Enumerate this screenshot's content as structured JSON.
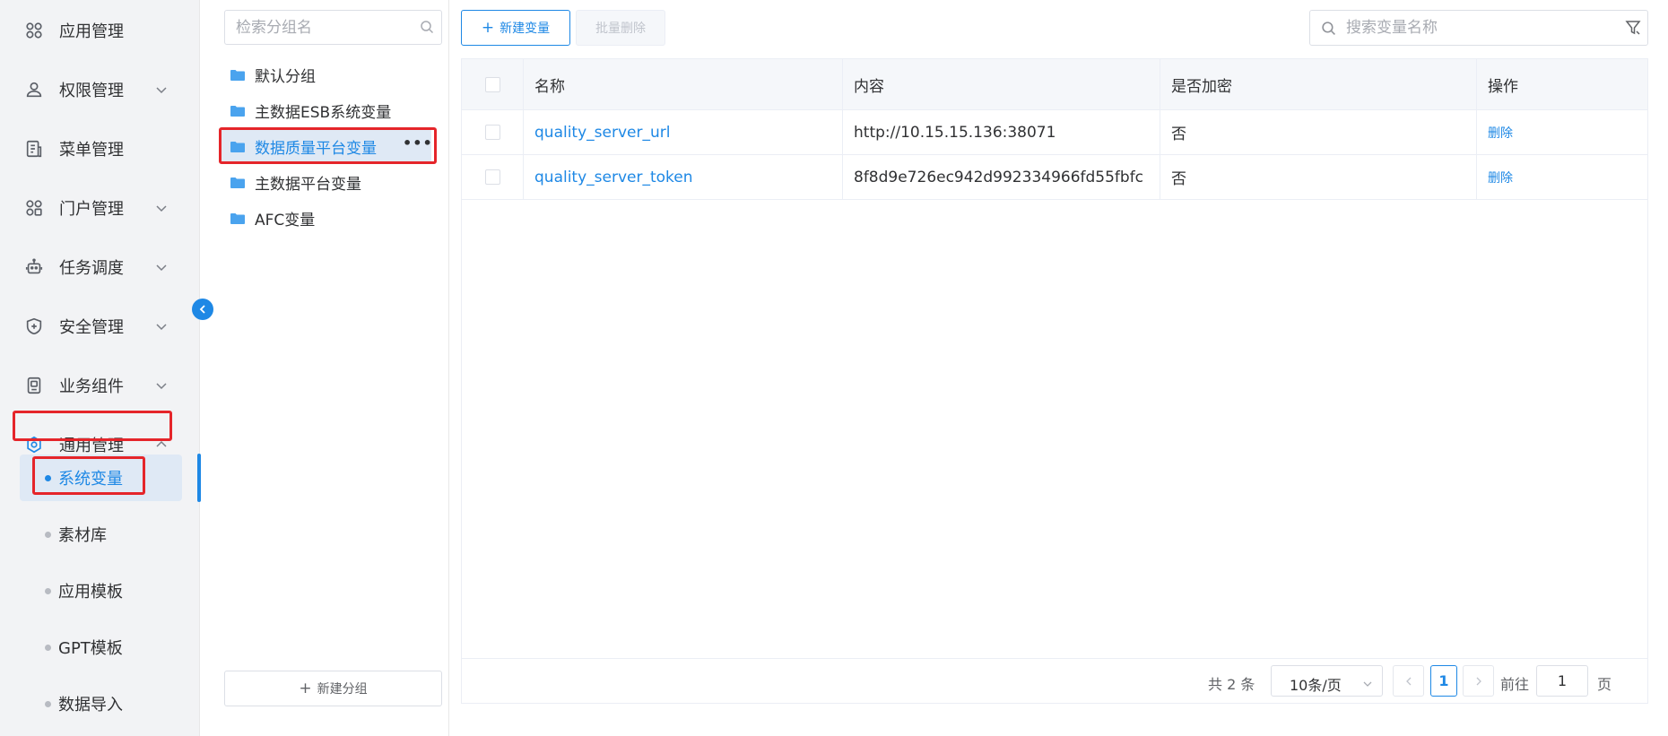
{
  "colors": {
    "accent": "#1e88e5",
    "highlight_border": "#e5252a",
    "nav_bg": "#f2f3f5"
  },
  "nav": {
    "items": [
      {
        "label": "应用管理",
        "icon": "grid-icon",
        "expandable": false
      },
      {
        "label": "权限管理",
        "icon": "user-icon",
        "expandable": true
      },
      {
        "label": "菜单管理",
        "icon": "menu-doc-icon",
        "expandable": false
      },
      {
        "label": "门户管理",
        "icon": "portal-grid-icon",
        "expandable": true
      },
      {
        "label": "任务调度",
        "icon": "robot-icon",
        "expandable": true
      },
      {
        "label": "安全管理",
        "icon": "shield-icon",
        "expandable": true
      },
      {
        "label": "业务组件",
        "icon": "component-icon",
        "expandable": true
      },
      {
        "label": "通用管理",
        "icon": "settings-icon",
        "expandable": true,
        "expanded": true
      }
    ],
    "subitems": [
      {
        "label": "系统变量",
        "selected": true
      },
      {
        "label": "素材库",
        "selected": false
      },
      {
        "label": "应用模板",
        "selected": false
      },
      {
        "label": "GPT模板",
        "selected": false
      },
      {
        "label": "数据导入",
        "selected": false
      }
    ]
  },
  "groups": {
    "search_placeholder": "检索分组名",
    "items": [
      {
        "label": "默认分组",
        "selected": false
      },
      {
        "label": "主数据ESB系统变量",
        "selected": false
      },
      {
        "label": "数据质量平台变量",
        "selected": true
      },
      {
        "label": "主数据平台变量",
        "selected": false
      },
      {
        "label": "AFC变量",
        "selected": false
      }
    ],
    "more_label": "•••",
    "new_group_label": "新建分组"
  },
  "toolbar": {
    "new_var_label": "新建变量",
    "batch_delete_label": "批量删除",
    "search_placeholder": "搜索变量名称"
  },
  "table": {
    "columns": [
      "名称",
      "内容",
      "是否加密",
      "操作"
    ],
    "rows": [
      {
        "name": "quality_server_url",
        "content": "http://10.15.15.136:38071",
        "encrypted": "否",
        "action": "删除"
      },
      {
        "name": "quality_server_token",
        "content": "8f8d9e726ec942d992334966fd55fbfc",
        "encrypted": "否",
        "action": "删除"
      }
    ]
  },
  "pagination": {
    "total_text": "共 2 条",
    "page_size": "10条/页",
    "current_page": "1",
    "goto_label": "前往",
    "goto_value": "1",
    "page_suffix": "页"
  }
}
